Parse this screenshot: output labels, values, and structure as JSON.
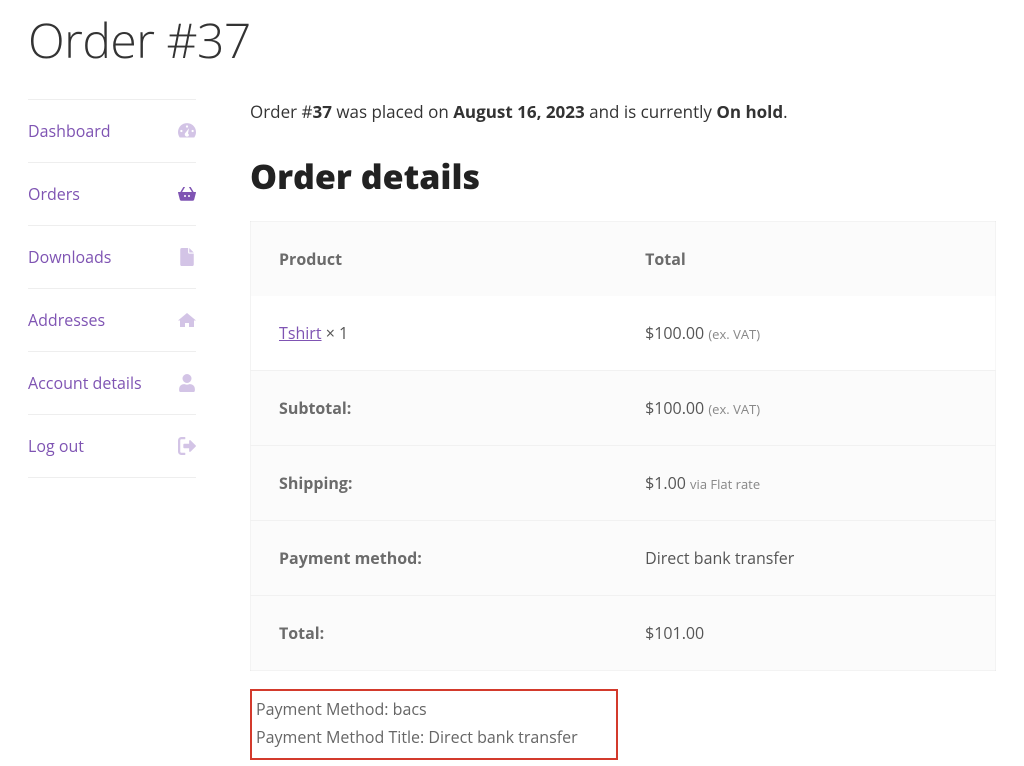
{
  "page_title": "Order #37",
  "sidebar": {
    "items": [
      {
        "label": "Dashboard",
        "icon": "dashboard-icon"
      },
      {
        "label": "Orders",
        "icon": "basket-icon",
        "active": true
      },
      {
        "label": "Downloads",
        "icon": "file-icon"
      },
      {
        "label": "Addresses",
        "icon": "home-icon"
      },
      {
        "label": "Account details",
        "icon": "user-icon"
      },
      {
        "label": "Log out",
        "icon": "signout-icon"
      }
    ]
  },
  "status": {
    "prefix": "Order #",
    "number": "37",
    "mid1": " was placed on ",
    "date": "August 16, 2023",
    "mid2": " and is currently ",
    "state": "On hold",
    "suffix": "."
  },
  "details": {
    "heading": "Order details",
    "columns": {
      "product": "Product",
      "total": "Total"
    },
    "items": [
      {
        "name": "Tshirt",
        "qty_sep": " × ",
        "qty": "1",
        "amount": "$100.00",
        "tax_note": "(ex. VAT)"
      }
    ],
    "rows": {
      "subtotal": {
        "label": "Subtotal:",
        "amount": "$100.00",
        "tax_note": "(ex. VAT)"
      },
      "shipping": {
        "label": "Shipping:",
        "amount": "$1.00",
        "method_note": "via Flat rate"
      },
      "payment": {
        "label": "Payment method:",
        "value": "Direct bank transfer"
      },
      "total": {
        "label": "Total:",
        "amount": "$101.00"
      }
    }
  },
  "debug": {
    "line1_label": "Payment Method: ",
    "line1_value": "bacs",
    "line2_label": "Payment Method Title: ",
    "line2_value": "Direct bank transfer"
  }
}
